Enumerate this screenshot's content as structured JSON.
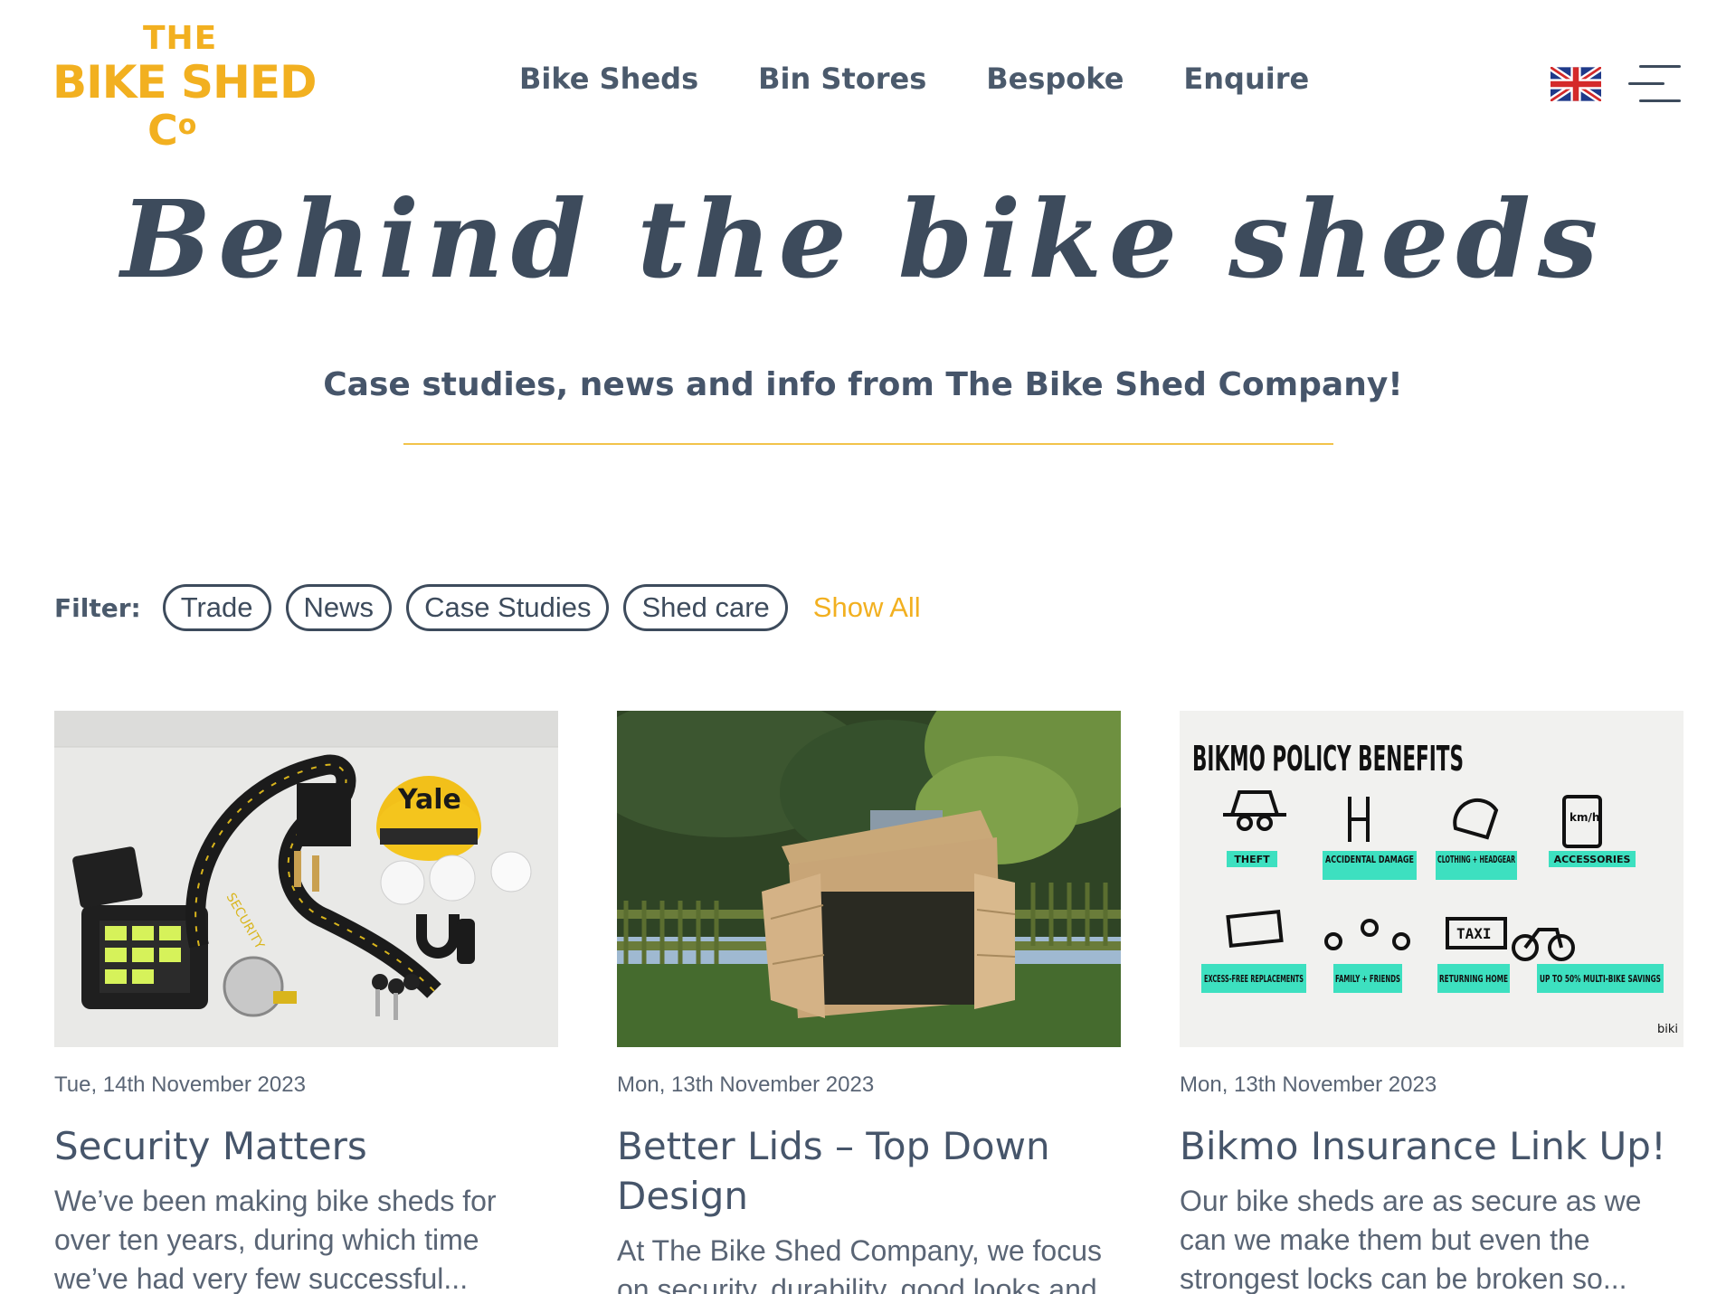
{
  "logo": {
    "line1": "THE",
    "line2": "BIKE SHED",
    "line3": "C",
    "line3_small": "o"
  },
  "nav": {
    "items": [
      "Bike Sheds",
      "Bin Stores",
      "Bespoke",
      "Enquire"
    ]
  },
  "hero": {
    "title": "Behind the bike sheds",
    "subtitle": "Case studies, news and info from The Bike Shed Company!"
  },
  "filter": {
    "label": "Filter:",
    "options": [
      "Trade",
      "News",
      "Case Studies",
      "Shed care"
    ],
    "show_all": "Show All"
  },
  "posts": [
    {
      "date": "Tue, 14th November 2023",
      "title": "Security Matters",
      "excerpt": "We’ve been making bike sheds for over ten years, during which time we’ve had very few successful..."
    },
    {
      "date": "Mon, 13th November 2023",
      "title": "Better Lids – Top Down Design",
      "excerpt": "At The Bike Shed Company, we focus on security, durability, good looks and"
    },
    {
      "date": "Mon, 13th November 2023",
      "title": "Bikmo Insurance Link Up!",
      "excerpt": "Our bike sheds are as secure as we can we make them but even the strongest locks can be broken so..."
    }
  ],
  "bikmo_graphic": {
    "heading": "BIKMO POLICY BENEFITS",
    "benefits": [
      "THEFT",
      "ACCIDENTAL DAMAGE",
      "CLOTHING + HEADGEAR",
      "ACCESSORIES",
      "EXCESS-FREE REPLACEMENTS",
      "FAMILY + FRIENDS",
      "RETURNING HOME",
      "UP TO 50% MULTI-BIKE SAVINGS"
    ],
    "brand": "biki",
    "km_label": "km/h",
    "taxi_label": "TAXI"
  },
  "security_graphic": {
    "lock_brand": "Yale",
    "chain_text": "SECURITY"
  },
  "colors": {
    "accent": "#f2b020",
    "text": "#3d4b5c",
    "benefit_green": "#3de0c0"
  }
}
